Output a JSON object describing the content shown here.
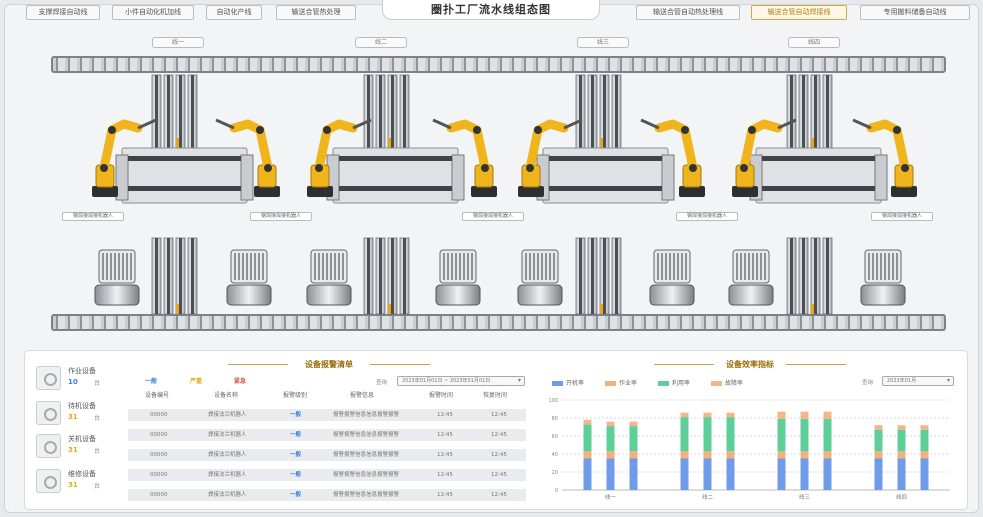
{
  "header": {
    "title": "圈扑工厂流水线组态图",
    "left_tabs": [
      "支撑焊接自动线",
      "小件自动化机加线",
      "自动化产线",
      "输送合管热处理"
    ],
    "right_tabs": [
      "输送合管自动热处理线",
      "输送合管自动焊接线",
      "专用搬料储备自动线"
    ],
    "active_right_tab": 1
  },
  "stations": [
    "线一",
    "线二",
    "线三",
    "线四"
  ],
  "robot_labels": [
    "钢焊接焊接机器人",
    "钢焊接焊接机器人",
    "钢焊接焊接机器人",
    "钢焊接焊接机器人",
    "钢焊接焊接机器人"
  ],
  "colors": {
    "accent": "#e6a817",
    "blue": "#4f7fe0",
    "orange": "#f2a36a",
    "green": "#45c48b",
    "peach": "#f3b581"
  },
  "status_panel": {
    "stats": [
      {
        "label": "作业设备",
        "value": "10",
        "unit": "台",
        "color": "#3d7be0"
      },
      {
        "label": "待机设备",
        "value": "31",
        "unit": "台",
        "color": "#e6a817"
      },
      {
        "label": "关机设备",
        "value": "31",
        "unit": "台",
        "color": "#e6a817"
      },
      {
        "label": "维修设备",
        "value": "31",
        "unit": "台",
        "color": "#e6a817"
      }
    ]
  },
  "alarm_panel": {
    "title": "设备报警清单",
    "filters": [
      "一般",
      "严重",
      "紧急"
    ],
    "filter_colors": [
      "#3d7be0",
      "#e6a817",
      "#d9534f"
    ],
    "query_label": "查询",
    "date_range": "2023年01月01日 ~ 2023年01月01日",
    "columns": [
      "设备编号",
      "设备名称",
      "报警级别",
      "报警信息",
      "报警时间",
      "恢复时间"
    ],
    "rows": [
      [
        "00000",
        "焊接法兰机器人",
        "一般",
        "报警报警信息信息报警报警",
        "12:45",
        "12:45"
      ],
      [
        "00000",
        "焊接法兰机器人",
        "一般",
        "报警报警信息信息报警报警",
        "12:45",
        "12:45"
      ],
      [
        "00000",
        "焊接法兰机器人",
        "一般",
        "报警报警信息信息报警报警",
        "12:45",
        "12:45"
      ],
      [
        "00000",
        "焊接法兰机器人",
        "一般",
        "报警报警信息信息报警报警",
        "12:45",
        "12:45"
      ],
      [
        "00000",
        "焊接法兰机器人",
        "一般",
        "报警报警信息信息报警报警",
        "12:45",
        "12:45"
      ]
    ]
  },
  "efficiency_panel": {
    "title": "设备效率指标",
    "query_label": "查询",
    "date": "2023年01月",
    "chart_data": {
      "type": "bar",
      "stacked": true,
      "categories": [
        "线一",
        "线一",
        "线一",
        "线二",
        "线二",
        "线二",
        "线三",
        "线三",
        "线三",
        "线四",
        "线四",
        "线四"
      ],
      "groups": [
        "线一",
        "线二",
        "线三",
        "线四"
      ],
      "series": [
        {
          "name": "开机率",
          "color": "#6f9be8",
          "values": [
            35,
            35,
            35,
            35,
            35,
            35,
            35,
            35,
            35,
            35,
            35,
            35
          ]
        },
        {
          "name": "作业率",
          "color": "#f2b07c",
          "values": [
            8,
            8,
            8,
            8,
            8,
            8,
            8,
            8,
            8,
            8,
            8,
            8
          ]
        },
        {
          "name": "利用率",
          "color": "#5fcf9a",
          "values": [
            30,
            28,
            28,
            38,
            38,
            38,
            36,
            36,
            36,
            24,
            24,
            24
          ]
        },
        {
          "name": "故障率",
          "color": "#f5b58a",
          "values": [
            5,
            5,
            5,
            5,
            5,
            5,
            8,
            8,
            8,
            5,
            5,
            5
          ]
        }
      ],
      "yticks": [
        "100",
        "80",
        "60",
        "40",
        "20",
        "0"
      ],
      "ylim": [
        0,
        100
      ],
      "legend_position": "top"
    }
  }
}
